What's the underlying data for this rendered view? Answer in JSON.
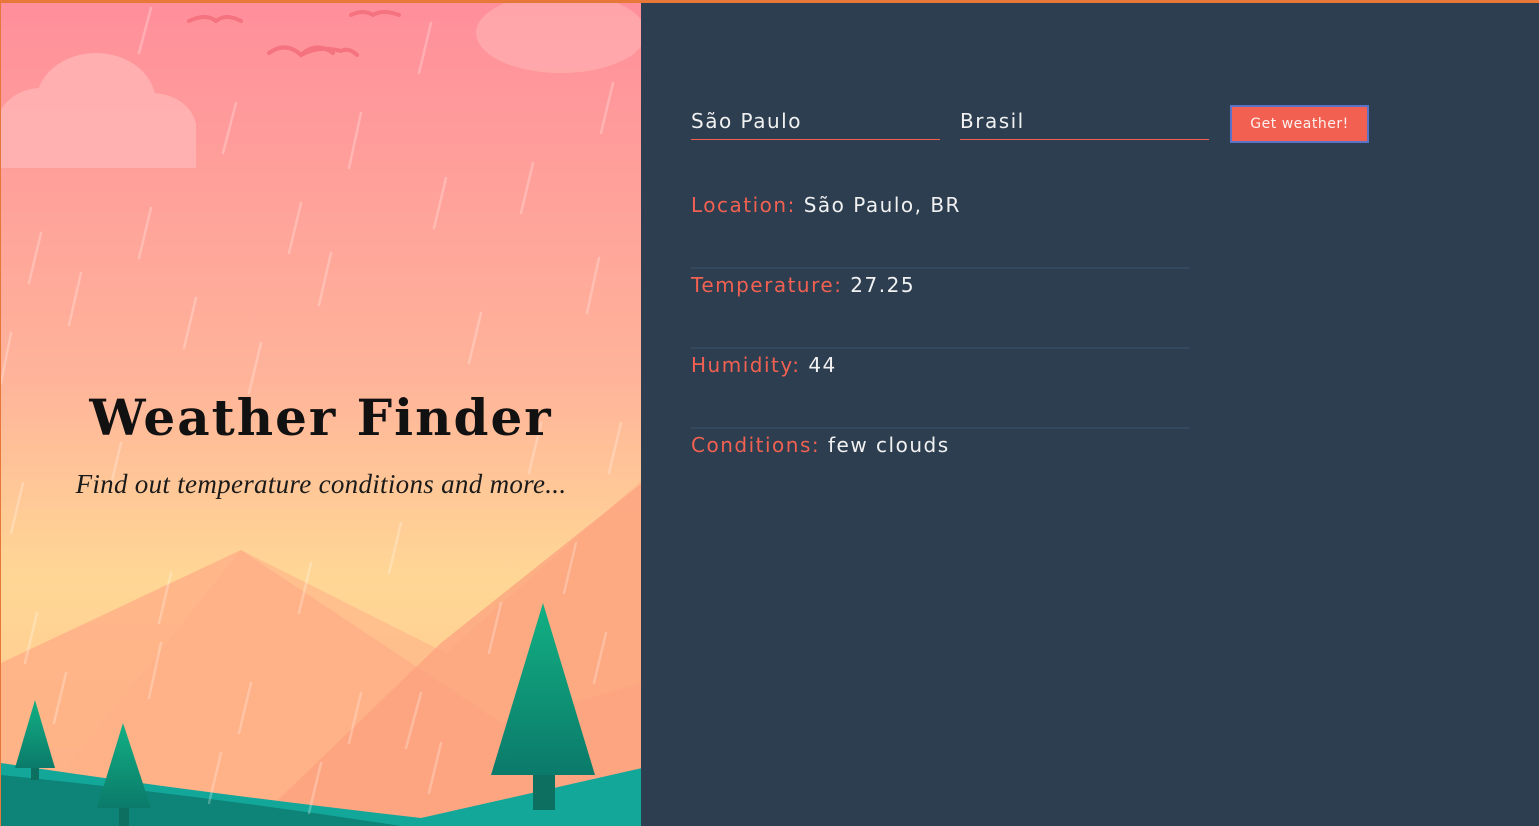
{
  "hero": {
    "title": "Weather Finder",
    "subtitle": "Find out temperature conditions and more..."
  },
  "form": {
    "city_value": "São Paulo",
    "country_value": "Brasil",
    "submit_label": "Get weather!"
  },
  "results": {
    "location_label": "Location:",
    "location_value": "São Paulo, BR",
    "temperature_label": "Temperature:",
    "temperature_value": "27.25",
    "humidity_label": "Humidity:",
    "humidity_value": "44",
    "conditions_label": "Conditions:",
    "conditions_value": "few clouds"
  },
  "colors": {
    "accent": "#f16051",
    "panel_bg": "#2c3e50",
    "divider": "#34495e",
    "window_border": "#e8783a"
  }
}
